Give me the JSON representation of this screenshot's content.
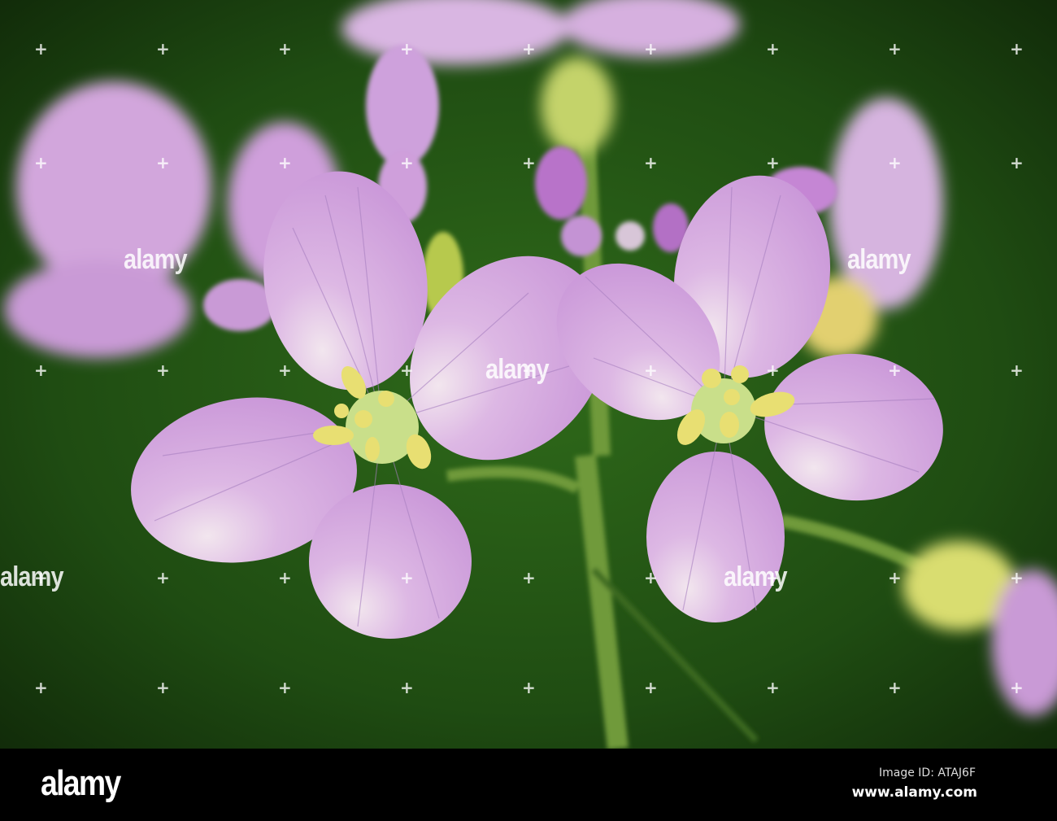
{
  "photo": {
    "subject": "cuckoo-flower",
    "colors": {
      "background": "#1f4a12",
      "petal": "#d8aee0",
      "vein": "#a77fbf",
      "stamen": "#e6e07a"
    }
  },
  "watermark": {
    "text": "alamy"
  },
  "footer": {
    "logo": "alamy",
    "image_id": "Image ID: ATAJ6F",
    "url": "www.alamy.com"
  }
}
